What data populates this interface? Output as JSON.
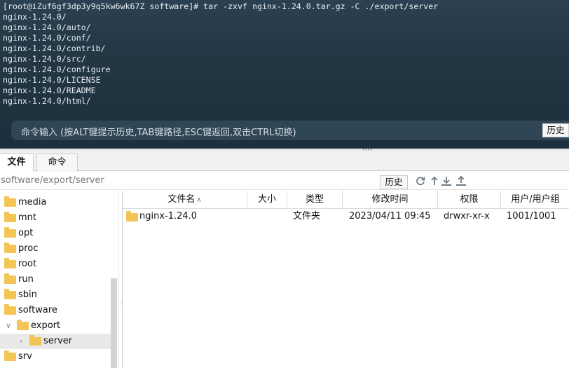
{
  "terminal": {
    "lines": [
      "[root@iZuf6gf3dp3y9q5kw6wk67Z software]# tar -zxvf nginx-1.24.0.tar.gz -C ./export/server",
      "nginx-1.24.0/",
      "nginx-1.24.0/auto/",
      "nginx-1.24.0/conf/",
      "nginx-1.24.0/contrib/",
      "nginx-1.24.0/src/",
      "nginx-1.24.0/configure",
      "nginx-1.24.0/LICENSE",
      "nginx-1.24.0/README",
      "nginx-1.24.0/html/"
    ],
    "command_placeholder": "命令输入 (按ALT键提示历史,TAB键路径,ESC键返回,双击CTRL切换)",
    "history_label": "历史"
  },
  "tabs": [
    {
      "label": "文件",
      "active": true
    },
    {
      "label": "命令",
      "active": false
    }
  ],
  "pathbar": {
    "path": "software/export/server",
    "history_label": "历史",
    "icons": [
      "refresh-icon",
      "up-directory-icon",
      "download-icon",
      "upload-icon"
    ]
  },
  "tree": {
    "items": [
      {
        "label": "media",
        "level": 0
      },
      {
        "label": "mnt",
        "level": 0
      },
      {
        "label": "opt",
        "level": 0
      },
      {
        "label": "proc",
        "level": 0
      },
      {
        "label": "root",
        "level": 0
      },
      {
        "label": "run",
        "level": 0
      },
      {
        "label": "sbin",
        "level": 0
      },
      {
        "label": "software",
        "level": 0
      },
      {
        "label": "export",
        "level": 1,
        "expanded": true
      },
      {
        "label": "server",
        "level": 2,
        "selected": true
      },
      {
        "label": "srv",
        "level": 0
      }
    ]
  },
  "filelist": {
    "columns": [
      "文件名",
      "大小",
      "类型",
      "修改时间",
      "权限",
      "用户/用户组"
    ],
    "rows": [
      {
        "name": "nginx-1.24.0",
        "size": "",
        "type": "文件夹",
        "modified": "2023/04/11 09:45",
        "permissions": "drwxr-xr-x",
        "owner": "1001/1001"
      }
    ]
  },
  "colors": {
    "terminal_bg": "#223644",
    "folder": "#f2c556",
    "selected_row": "#e9e9e9"
  }
}
